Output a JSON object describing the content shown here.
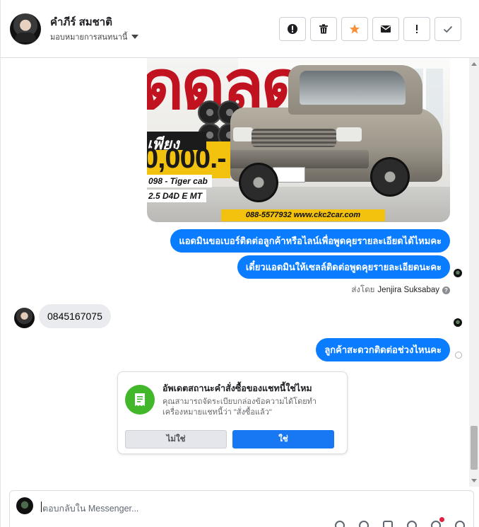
{
  "header": {
    "contact_name": "คำภีร์ สมชาติ",
    "assign_label": "มอบหมายการสนทนานี้",
    "actions": [
      {
        "name": "report-spam-button",
        "icon": "alert-circle-icon"
      },
      {
        "name": "delete-button",
        "icon": "trash-icon"
      },
      {
        "name": "star-button",
        "icon": "star-icon",
        "color": "#f7923b"
      },
      {
        "name": "mark-unread-button",
        "icon": "envelope-icon"
      },
      {
        "name": "follow-up-button",
        "icon": "exclamation-icon"
      },
      {
        "name": "mark-done-button",
        "icon": "check-icon"
      }
    ]
  },
  "ad_image": {
    "headline_text": "ดดลด",
    "price_word": "เพียง",
    "price": "0,000.-",
    "model_line1": "098 - Tiger cab",
    "model_line2": "2.5 D4D E MT",
    "contact_line": "088-5577932 www.ckc2car.com"
  },
  "messages": {
    "out_1": "แอดมินขอเบอร์ติดต่อลูกค้าหรือไลน์เพื่อพูดคุยรายละเอียดได้ไหมคะ",
    "out_2": "เดี๋ยวแอดมินให้เซลล์ติดต่อพูดคุยรายละเอียดนะคะ",
    "sent_by_label": "ส่งโดย",
    "sent_by_agent": "Jenjira Suksabay",
    "in_1": "0845167075",
    "out_3": "ลูกค้าสะดวกติดต่อช่วงไหนคะ"
  },
  "order_card": {
    "title": "อัพเดตสถานะคำสั่งซื้อของแชทนี้ใช่ไหม",
    "body": "คุณสามารถจัดระเบียบกล่องข้อความได้โดยทำเครื่องหมายแชทนี้ว่า \"สั่งซื้อแล้ว\"",
    "no_label": "ไม่ใช่",
    "yes_label": "ใช่",
    "icon": "receipt-icon",
    "icon_color": "#42b72a"
  },
  "composer": {
    "placeholder": "ตอบกลับใน Messenger..."
  },
  "colors": {
    "bubble_out": "#0a7cff",
    "bubble_in": "#e9ebee",
    "primary_button": "#1877f2"
  }
}
